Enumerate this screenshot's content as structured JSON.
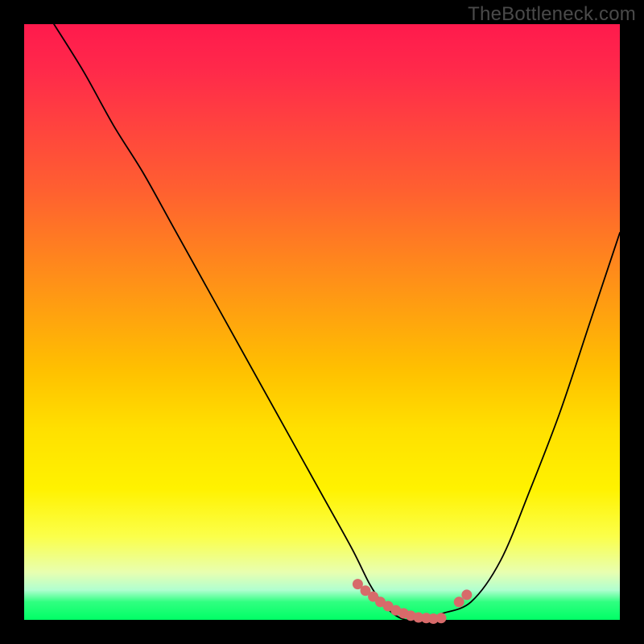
{
  "watermark": "TheBottleneck.com",
  "colors": {
    "frame": "#000000",
    "curve": "#000000",
    "marker": "#d76a6a"
  },
  "chart_data": {
    "type": "line",
    "title": "",
    "xlabel": "",
    "ylabel": "",
    "xlim": [
      0,
      100
    ],
    "ylim": [
      0,
      100
    ],
    "grid": false,
    "legend": false,
    "x": [
      5,
      10,
      15,
      20,
      25,
      30,
      35,
      40,
      45,
      50,
      55,
      58,
      60,
      62,
      64,
      66,
      68,
      70,
      75,
      80,
      85,
      90,
      95,
      100
    ],
    "values": [
      100,
      92,
      83,
      75,
      66,
      57,
      48,
      39,
      30,
      21,
      12,
      6,
      3,
      1,
      0,
      0,
      0,
      1,
      3,
      10,
      22,
      35,
      50,
      65
    ],
    "markers": {
      "x": [
        56.0,
        57.3,
        58.6,
        59.8,
        61.1,
        62.4,
        63.7,
        64.9,
        66.2,
        67.5,
        68.7,
        70.0,
        73.0,
        74.3
      ],
      "y": [
        6.0,
        4.9,
        3.9,
        3.0,
        2.3,
        1.6,
        1.1,
        0.7,
        0.4,
        0.3,
        0.2,
        0.3,
        3.0,
        4.2
      ]
    }
  }
}
